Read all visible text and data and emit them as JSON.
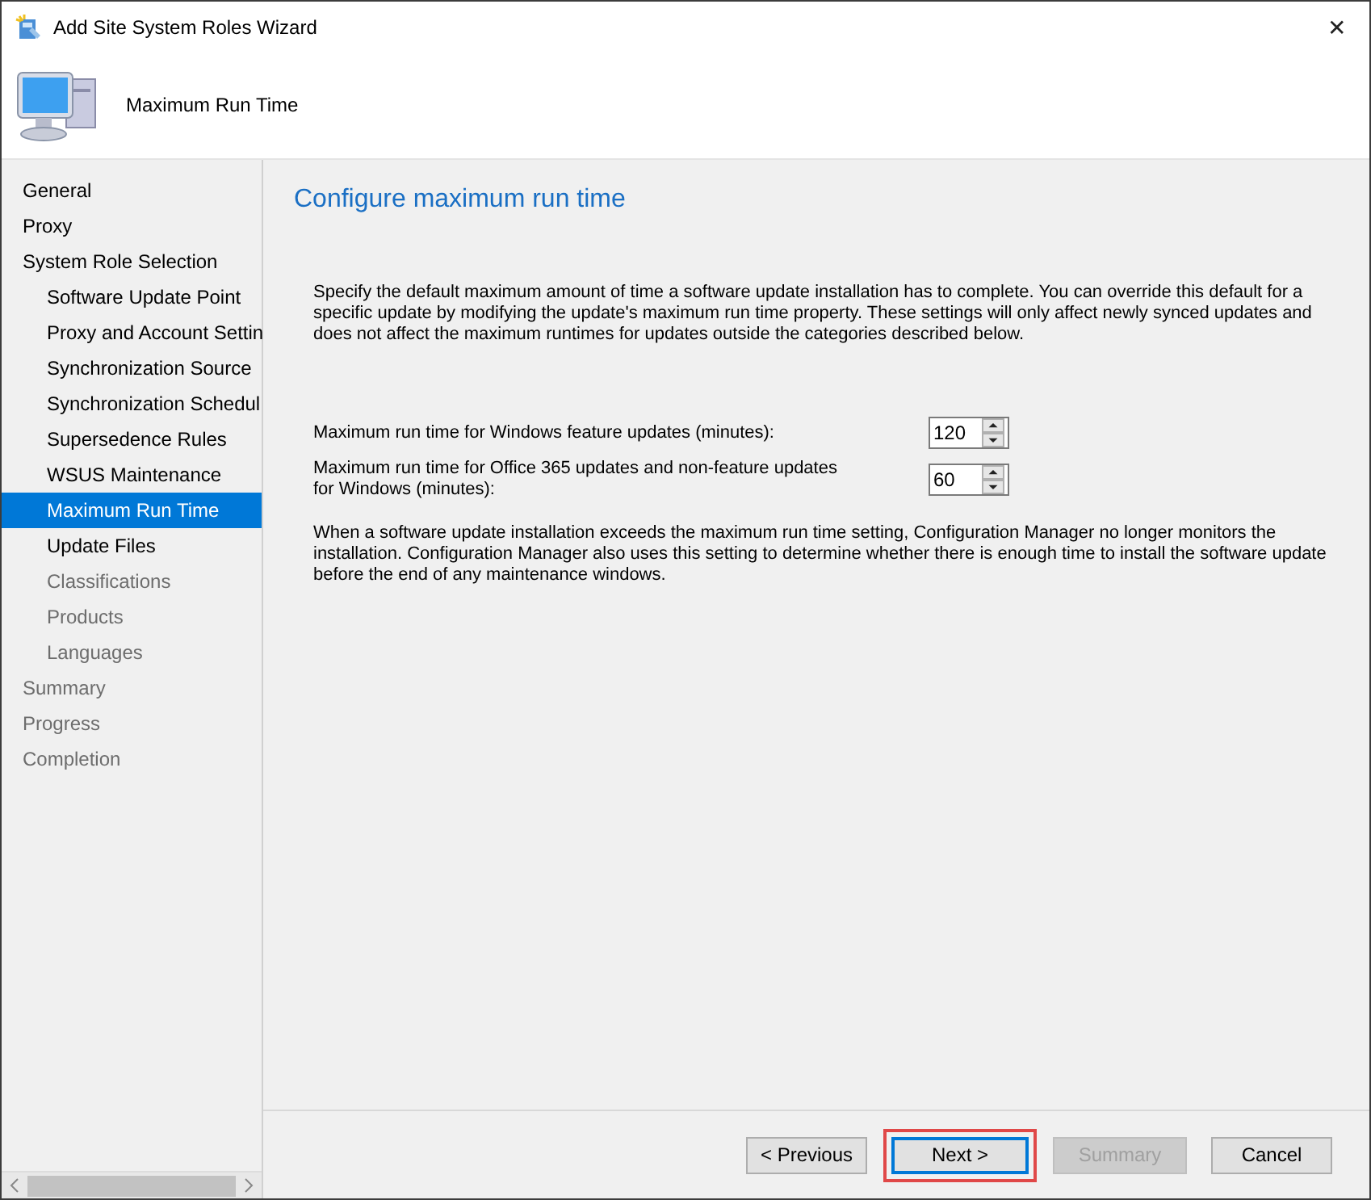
{
  "window": {
    "title": "Add Site System Roles Wizard",
    "close": "✕"
  },
  "header": {
    "title": "Maximum Run Time"
  },
  "sidebar": {
    "items": [
      {
        "label": "General",
        "selected": false,
        "disabled": false
      },
      {
        "label": "Proxy",
        "selected": false,
        "disabled": false
      },
      {
        "label": "System Role Selection",
        "selected": false,
        "disabled": false,
        "children": [
          {
            "label": "Software Update Point",
            "selected": false,
            "disabled": false
          },
          {
            "label": "Proxy and Account Settin",
            "selected": false,
            "disabled": false
          },
          {
            "label": "Synchronization Source",
            "selected": false,
            "disabled": false
          },
          {
            "label": "Synchronization Schedul",
            "selected": false,
            "disabled": false
          },
          {
            "label": "Supersedence Rules",
            "selected": false,
            "disabled": false
          },
          {
            "label": "WSUS Maintenance",
            "selected": false,
            "disabled": false
          },
          {
            "label": "Maximum Run Time",
            "selected": true,
            "disabled": false
          },
          {
            "label": "Update Files",
            "selected": false,
            "disabled": false
          },
          {
            "label": "Classifications",
            "selected": false,
            "disabled": true
          },
          {
            "label": "Products",
            "selected": false,
            "disabled": true
          },
          {
            "label": "Languages",
            "selected": false,
            "disabled": true
          }
        ]
      },
      {
        "label": "Summary",
        "selected": false,
        "disabled": true
      },
      {
        "label": "Progress",
        "selected": false,
        "disabled": true
      },
      {
        "label": "Completion",
        "selected": false,
        "disabled": true
      }
    ]
  },
  "content": {
    "heading": "Configure maximum run time",
    "intro": "Specify the default maximum amount of time a software update installation has to complete. You can override this default for a specific update by modifying the update's maximum run time property. These settings will only affect newly synced updates and does not affect the maximum runtimes for updates outside the categories described below.",
    "fields": [
      {
        "label": "Maximum run time for Windows feature updates (minutes):",
        "value": "120"
      },
      {
        "label": "Maximum run time for Office 365 updates and non-feature updates for Windows (minutes):",
        "value": "60"
      }
    ],
    "note": "When a software update installation exceeds the maximum run time setting, Configuration Manager no longer monitors the installation. Configuration Manager also uses this setting to determine whether there is enough time to install the software update before the end of any maintenance windows."
  },
  "buttons": [
    {
      "label": "< Previous",
      "disabled": false,
      "default": false,
      "highlighted": false
    },
    {
      "label": "Next >",
      "disabled": false,
      "default": true,
      "highlighted": true
    },
    {
      "label": "Summary",
      "disabled": true,
      "default": false,
      "highlighted": false
    },
    {
      "label": "Cancel",
      "disabled": false,
      "default": false,
      "highlighted": false
    }
  ]
}
